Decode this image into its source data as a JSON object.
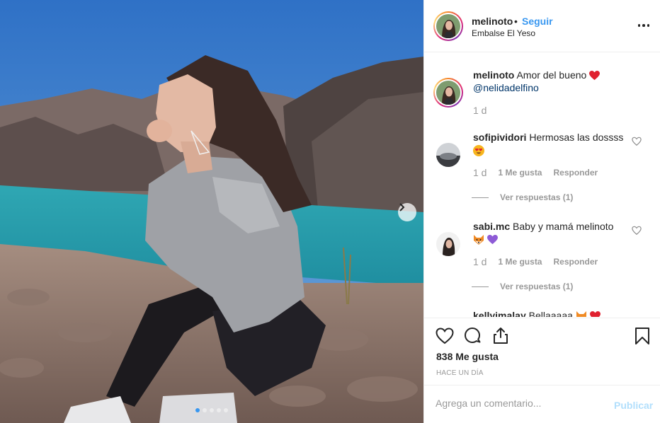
{
  "post": {
    "author": "melinoto",
    "separator": "•",
    "follow_label": "Seguir",
    "location": "Embalse El Yeso",
    "carousel": {
      "count": 5,
      "active_index": 0
    }
  },
  "caption": {
    "username": "melinoto",
    "text": "Amor del bueno",
    "emoji": "red-heart",
    "mention": "@nelidadelfino",
    "time": "1 d"
  },
  "comments": [
    {
      "username": "sofipividori",
      "text": "Hermosas las dossss",
      "emoji": [
        "heart-eyes"
      ],
      "time": "1 d",
      "likes_label": "1 Me gusta",
      "reply_label": "Responder",
      "view_replies": "Ver respuestas (1)"
    },
    {
      "username": "sabi.mc",
      "text": "Baby y mamá melinoto",
      "emoji": [
        "fox",
        "purple-heart"
      ],
      "time": "1 d",
      "likes_label": "1 Me gusta",
      "reply_label": "Responder",
      "view_replies": "Ver respuestas (1)"
    },
    {
      "username": "kellyimalay",
      "text": "Bellaaaaa",
      "emoji": [
        "fox",
        "red-heart"
      ]
    }
  ],
  "actions": {
    "likes": "838 Me gusta",
    "time": "HACE UN DÍA",
    "icons": [
      "heart-icon",
      "comment-icon",
      "share-icon",
      "bookmark-icon"
    ]
  },
  "add_comment": {
    "placeholder": "Agrega un comentario...",
    "post_label": "Publicar"
  },
  "colors": {
    "link": "#3897f0",
    "mention": "#003569",
    "muted": "#999999",
    "post_disabled": "#b2dffc"
  }
}
